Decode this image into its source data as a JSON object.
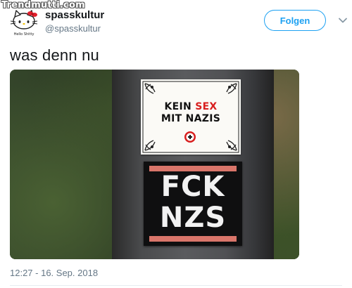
{
  "watermark": "Trendmutti.com",
  "user": {
    "display_name": "spasskultur",
    "handle": "@spasskultur",
    "avatar_caption": "Hello Shitty",
    "avatar_icon": "hello-kitty-avatar-icon"
  },
  "follow_button": {
    "label": "Folgen"
  },
  "menu_icon": "chevron-down-icon",
  "tweet": {
    "text": "was denn nu",
    "timestamp": "12:27 - 16. Sep. 2018"
  },
  "media": {
    "sticker_top": {
      "line1_a": "KEIN ",
      "line1_red": "SEX",
      "line2": "MIT NAZIS"
    },
    "sticker_bottom": {
      "line1": "FCK",
      "line2": "NZS"
    }
  },
  "colors": {
    "accent": "#1da1f2",
    "text": "#14171a",
    "muted": "#657786",
    "sticker_red": "#d81e1e",
    "stripe": "#d9756a"
  }
}
